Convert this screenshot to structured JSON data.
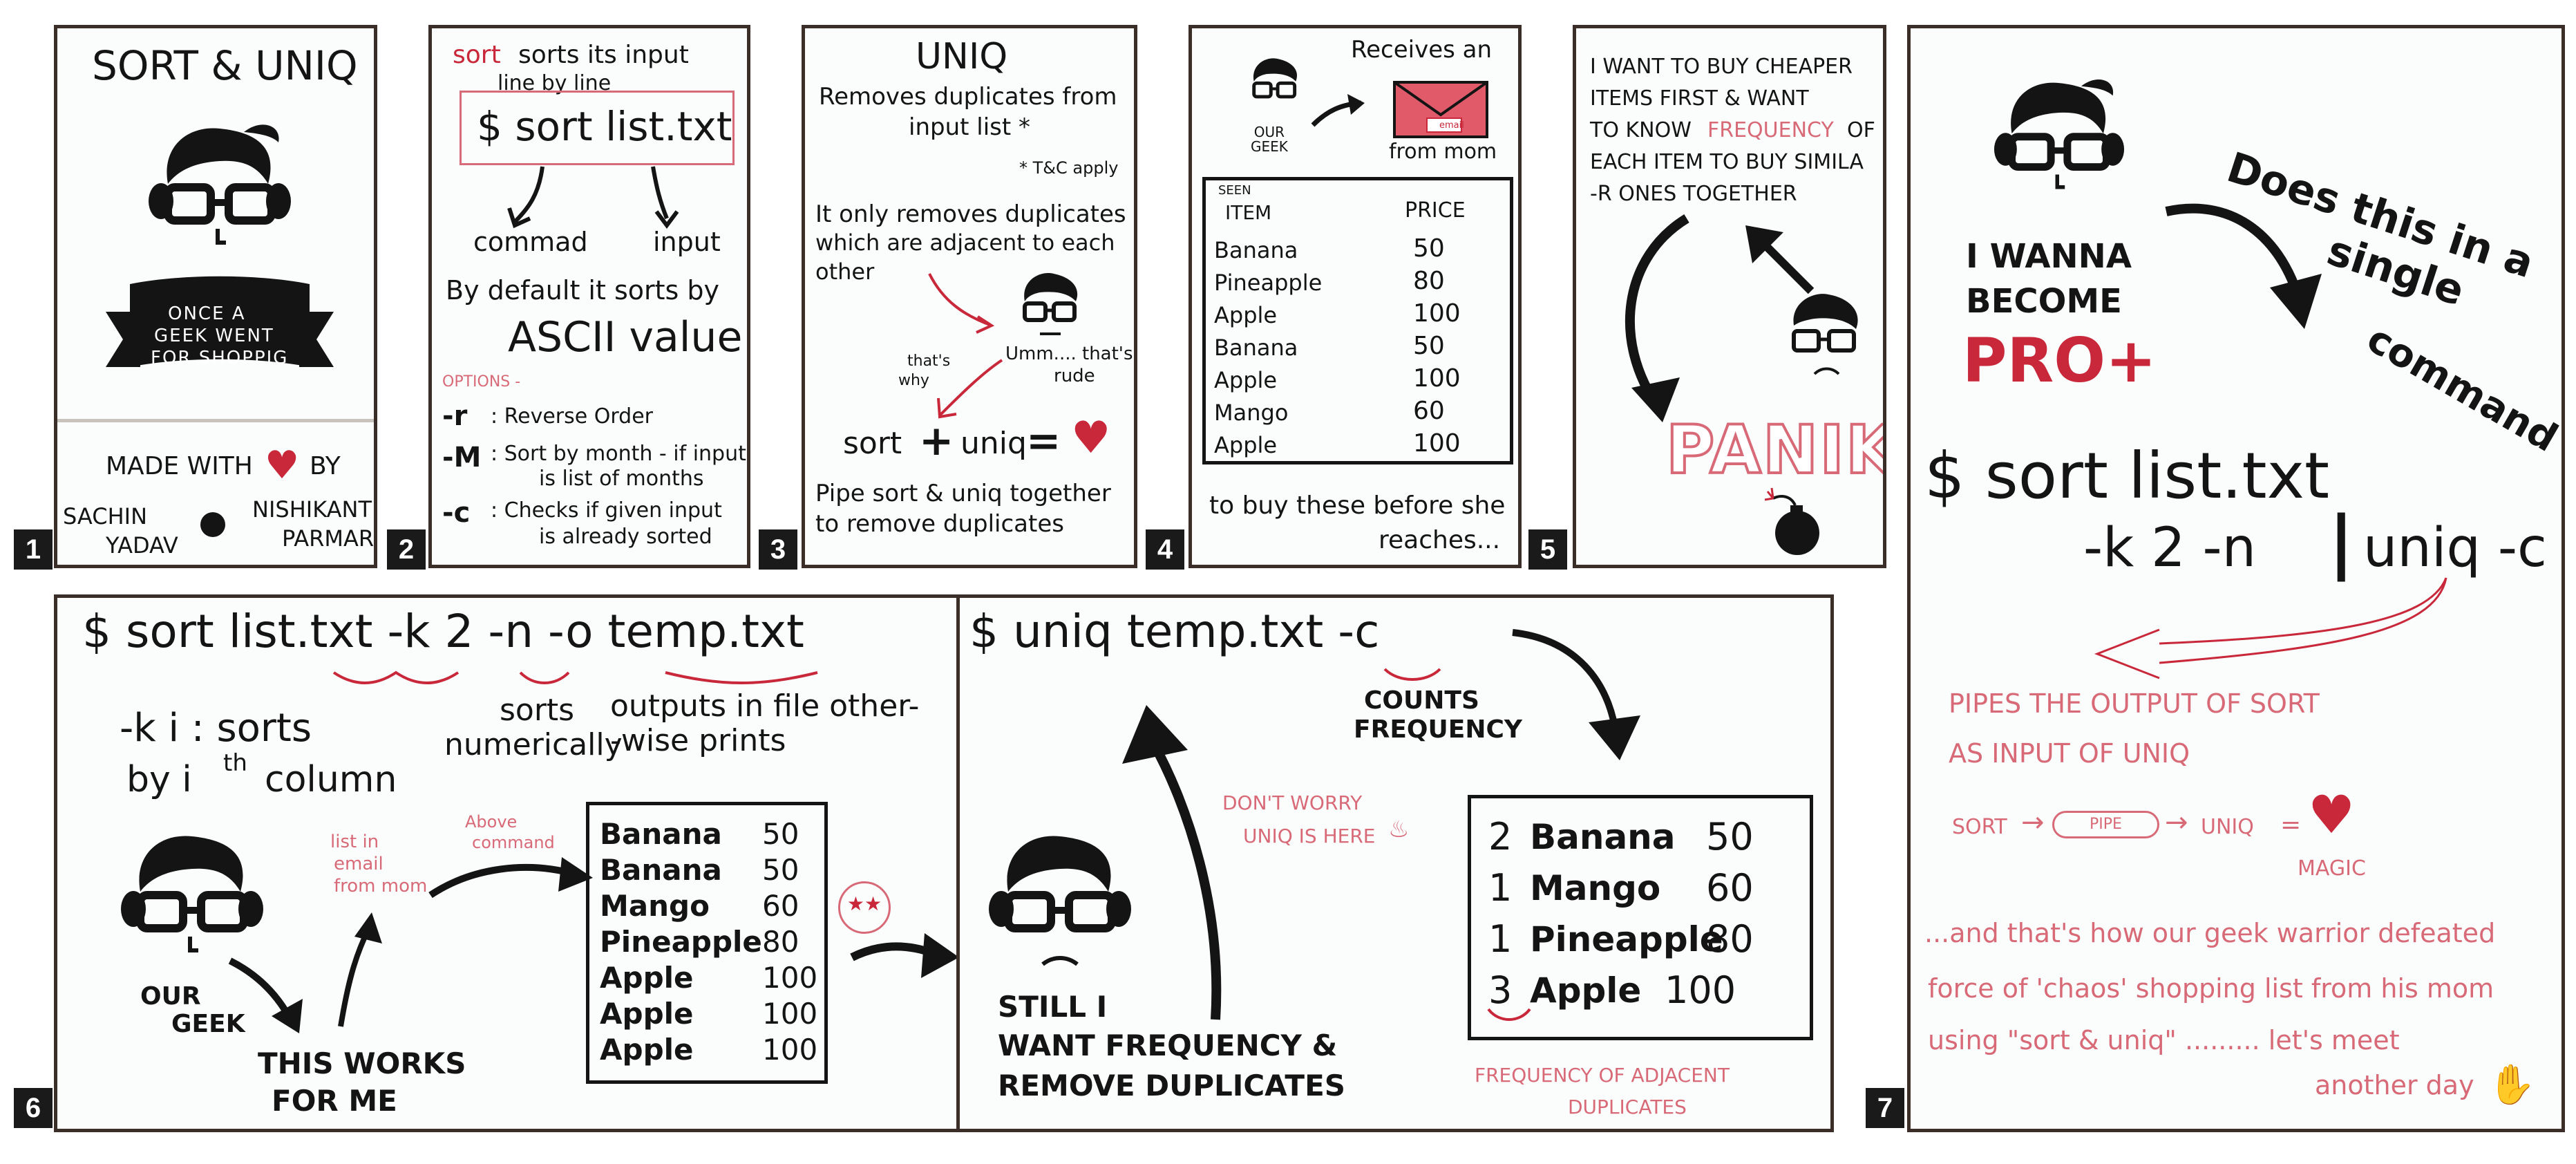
{
  "panels": {
    "p1": {
      "number": "1",
      "title": "SORT & UNIQ",
      "banner": [
        "ONCE A",
        "GEEK WENT",
        "FOR SHOPPIG"
      ],
      "made_with": "MADE WITH",
      "by": "BY",
      "author1_first": "SACHIN",
      "author1_last": "YADAV",
      "author2_first": "NISHIKANT",
      "author2_last": "PARMAR"
    },
    "p2": {
      "number": "2",
      "sort_word": "sort",
      "line1": "sorts its input",
      "line2": "line by line",
      "command": "$ sort  list.txt",
      "label_command": "commad",
      "label_input": "input",
      "default1": "By default it sorts by",
      "default2": "ASCII value",
      "options_label": "OPTIONS -",
      "opt_r_flag": "-r",
      "opt_r_desc": ": Reverse Order",
      "opt_m_flag": "-M",
      "opt_m_desc1": ": Sort by month - if input",
      "opt_m_desc2": "is list of months",
      "opt_c_flag": "-c",
      "opt_c_desc1": ": Checks if given input",
      "opt_c_desc2": "is already sorted"
    },
    "p3": {
      "number": "3",
      "title": "UNIQ",
      "line1": "Removes duplicates from",
      "line2": "input list *",
      "tnc": "* T&C apply",
      "only1": "It only removes duplicates",
      "only2": "which are adjacent to each",
      "only3": "other",
      "umm1": "Umm.... that's",
      "umm2": "rude",
      "thats1": "that's",
      "thats2": "why",
      "eq_sort": "sort",
      "eq_uniq": "uniq",
      "pipe1": "Pipe sort & uniq together",
      "pipe2": "to remove duplicates"
    },
    "p4": {
      "number": "4",
      "receives": "Receives an",
      "email_label": "email",
      "from_mom": "from mom",
      "our_geek": "OUR\nGEEK",
      "seen": "SEEN",
      "col_item": "ITEM",
      "col_price": "PRICE",
      "items": [
        {
          "name": "Banana",
          "price": "50"
        },
        {
          "name": "Pineapple",
          "price": "80"
        },
        {
          "name": "Apple",
          "price": "100"
        },
        {
          "name": "Banana",
          "price": "50"
        },
        {
          "name": "Apple",
          "price": "100"
        },
        {
          "name": "Mango",
          "price": "60"
        },
        {
          "name": "Apple",
          "price": "100"
        }
      ],
      "footer1": "to buy these before she",
      "footer2": "reaches..."
    },
    "p5": {
      "number": "5",
      "lines": [
        "I WANT TO BUY CHEAPER",
        "ITEMS FIRST & WANT",
        "TO KNOW",
        "OF",
        "EACH ITEM TO BUY SIMILA",
        "-R ONES TOGETHER"
      ],
      "frequency_word": "FREQUENCY",
      "panik": "PANIK"
    },
    "p6": {
      "number": "6",
      "command": "$ sort  list.txt  -k 2  -n  -o  temp.txt",
      "k1": "-k  i  : sorts",
      "k2": "by  i",
      "k2_sup": "th",
      "k2_end": "column",
      "sorts1": "sorts",
      "sorts2": "numerically",
      "outputs1": "outputs in file other-",
      "outputs2": "-wise prints",
      "list_in": [
        "list in",
        "email",
        "from mom"
      ],
      "above": [
        "Above",
        "command"
      ],
      "items": [
        {
          "name": "Banana",
          "price": "50"
        },
        {
          "name": "Banana",
          "price": "50"
        },
        {
          "name": "Mango",
          "price": "60"
        },
        {
          "name": "Pineapple",
          "price": "80"
        },
        {
          "name": "Apple",
          "price": "100"
        },
        {
          "name": "Apple",
          "price": "100"
        },
        {
          "name": "Apple",
          "price": "100"
        }
      ],
      "our_geek1": "OUR",
      "our_geek2": "GEEK",
      "works1": "THIS WORKS",
      "works2": "FOR ME"
    },
    "p6b": {
      "command": "$ uniq   temp.txt   -c",
      "counts1": "COUNTS",
      "counts2": "FREQUENCY",
      "dont1": "DON'T WORRY",
      "dont2": "UNIQ IS HERE",
      "still1": "STILL I",
      "still2": "WANT FREQUENCY &",
      "still3": "REMOVE  DUPLICATES",
      "results": [
        {
          "count": "2",
          "name": "Banana",
          "price": "50"
        },
        {
          "count": "1",
          "name": "Mango",
          "price": "60"
        },
        {
          "count": "1",
          "name": "Pineapple",
          "price": "80"
        },
        {
          "count": "3",
          "name": "Apple",
          "price": "100"
        }
      ],
      "freq1": "FREQUENCY  OF  ADJACENT",
      "freq2": "DUPLICATES"
    },
    "p7": {
      "number": "7",
      "wanna1": "I WANNA",
      "wanna2": "BECOME",
      "pro": "PRO+",
      "does1": "Does this in a",
      "does2": "single",
      "does3": "command",
      "cmd1": "$ sort  list.txt",
      "cmd2": "-k  2  -n",
      "cmd_pipe": "|",
      "cmd3": "uniq  -c",
      "pipes1": "PIPES  THE  OUTPUT  OF  SORT",
      "pipes2": "AS  INPUT  OF  UNIQ",
      "flow_sort": "SORT",
      "flow_pipe": "PIPE",
      "flow_uniq": "UNIQ",
      "flow_eq": "=",
      "magic": "MAGIC",
      "end1": "...and  that's  how  our geek  warrior  defeated",
      "end2": "force  of   'chaos'  shopping  list  from his  mom",
      "end3": "using   \"sort  &  uniq\" .........  let's  meet",
      "end4": "another  day"
    }
  },
  "colors": {
    "ink": "#141414",
    "red": "#c8283a",
    "pink": "#d86a78",
    "frame": "#3b2e28"
  }
}
